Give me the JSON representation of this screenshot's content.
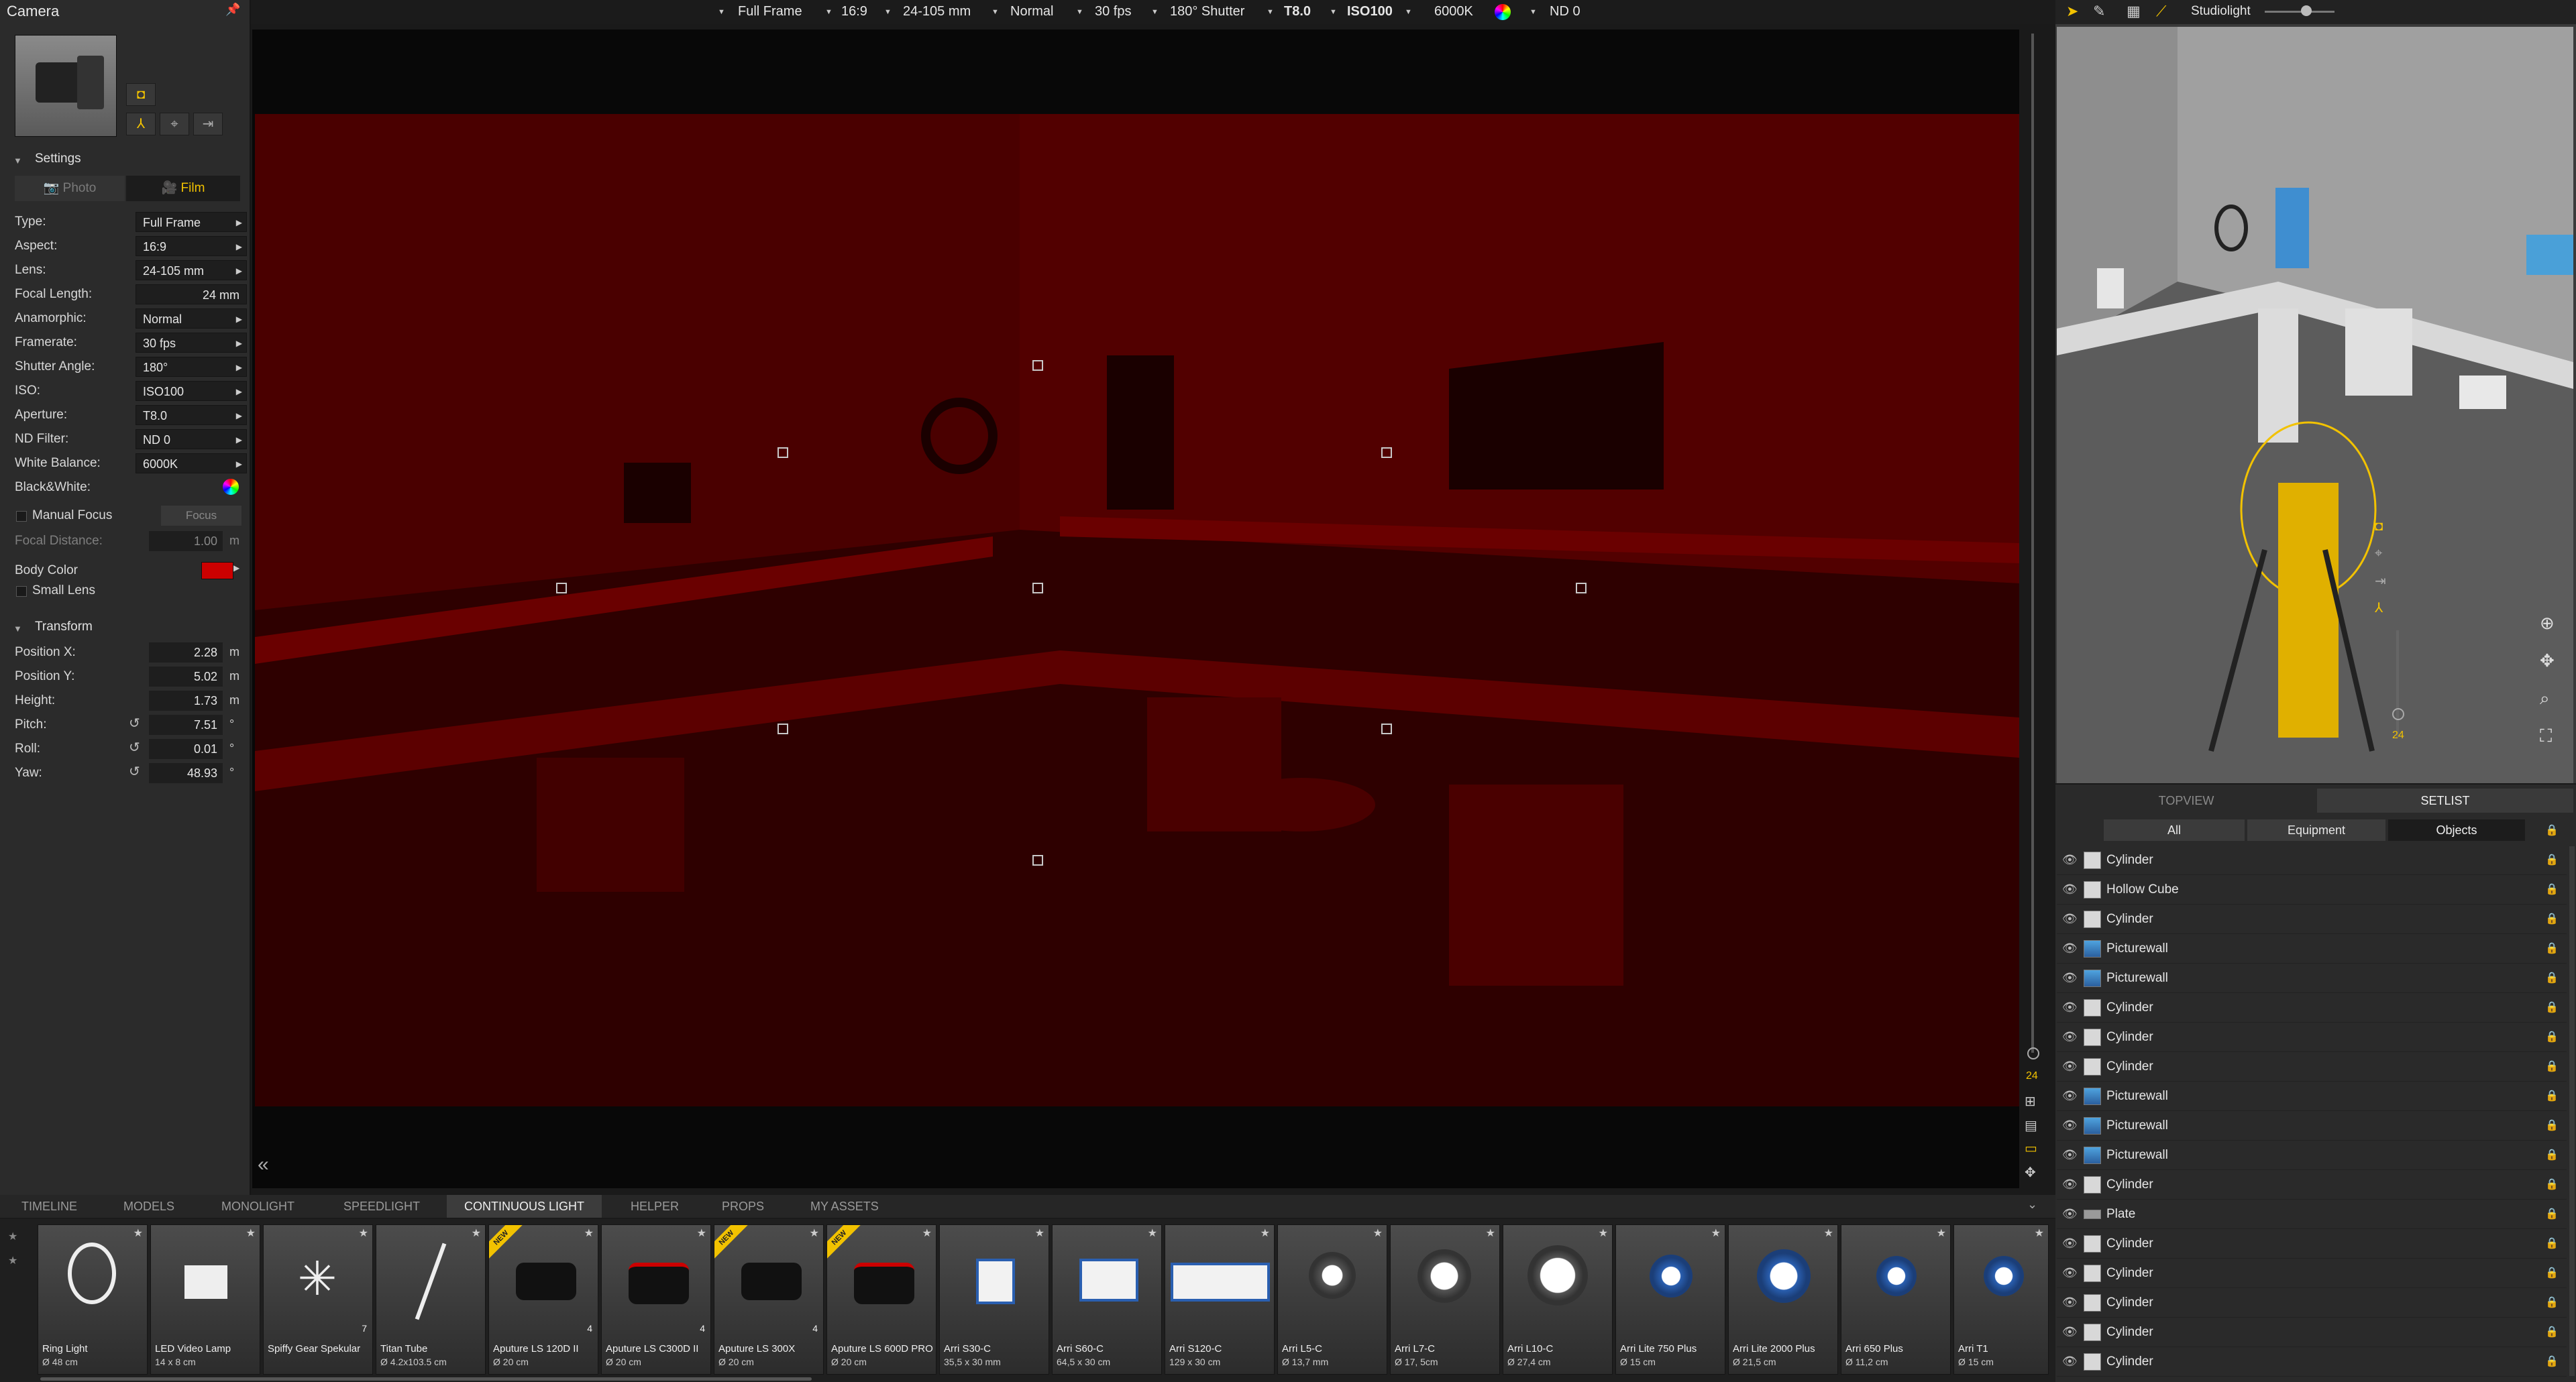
{
  "left_panel": {
    "title": "Camera",
    "settings_label": "Settings",
    "mode_photo": "Photo",
    "mode_film": "Film",
    "settings": [
      {
        "label": "Type:",
        "value": "Full Frame"
      },
      {
        "label": "Aspect:",
        "value": "16:9"
      },
      {
        "label": "Lens:",
        "value": "24-105 mm"
      },
      {
        "label": "Focal Length:",
        "value": "24 mm"
      },
      {
        "label": "Anamorphic:",
        "value": "Normal"
      },
      {
        "label": "Framerate:",
        "value": "30 fps"
      },
      {
        "label": "Shutter Angle:",
        "value": "180°"
      },
      {
        "label": "ISO:",
        "value": "ISO100"
      },
      {
        "label": "Aperture:",
        "value": "T8.0"
      },
      {
        "label": "ND Filter:",
        "value": "ND 0"
      },
      {
        "label": "White Balance:",
        "value": "6000K"
      },
      {
        "label": "Black&White:",
        "value": ""
      }
    ],
    "manual_focus_label": "Manual Focus",
    "focus_button": "Focus",
    "focal_distance_label": "Focal Distance:",
    "focal_distance_value": "1.00",
    "focal_distance_unit": "m",
    "body_color_label": "Body Color",
    "body_color": "#cc0000",
    "small_lens_label": "Small Lens",
    "transform_label": "Transform",
    "transform": [
      {
        "label": "Position X:",
        "value": "2.28",
        "unit": "m"
      },
      {
        "label": "Position Y:",
        "value": "5.02",
        "unit": "m"
      },
      {
        "label": "Height:",
        "value": "1.73",
        "unit": "m"
      },
      {
        "label": "Pitch:",
        "value": "7.51",
        "unit": "°"
      },
      {
        "label": "Roll:",
        "value": "0.01",
        "unit": "°"
      },
      {
        "label": "Yaw:",
        "value": "48.93",
        "unit": "°"
      }
    ]
  },
  "toolbar": {
    "items": [
      "Full Frame",
      "16:9",
      "24-105 mm",
      "Normal",
      "30 fps",
      "180° Shutter",
      "T8.0",
      "ISO100",
      "6000K",
      "ND 0"
    ]
  },
  "right_panel": {
    "mode_label": "Studiolight",
    "zoom_level": "24",
    "view_tabs": [
      "TOPVIEW",
      "SETLIST"
    ],
    "filter_tabs": [
      "All",
      "Equipment",
      "Objects"
    ],
    "objects": [
      {
        "name": "Cylinder",
        "icon": "cylinder"
      },
      {
        "name": "Hollow Cube",
        "icon": "cube"
      },
      {
        "name": "Cylinder",
        "icon": "cylinder"
      },
      {
        "name": "Picturewall",
        "icon": "picture"
      },
      {
        "name": "Picturewall",
        "icon": "picture"
      },
      {
        "name": "Cylinder",
        "icon": "cylinder"
      },
      {
        "name": "Cylinder",
        "icon": "cylinder"
      },
      {
        "name": "Cylinder",
        "icon": "cylinder"
      },
      {
        "name": "Picturewall",
        "icon": "picture"
      },
      {
        "name": "Picturewall",
        "icon": "picture"
      },
      {
        "name": "Picturewall",
        "icon": "picture"
      },
      {
        "name": "Cylinder",
        "icon": "cylinder"
      },
      {
        "name": "Plate",
        "icon": "plate"
      },
      {
        "name": "Cylinder",
        "icon": "cylinder"
      },
      {
        "name": "Cylinder",
        "icon": "cylinder"
      },
      {
        "name": "Cylinder",
        "icon": "cylinder"
      },
      {
        "name": "Cylinder",
        "icon": "cylinder"
      },
      {
        "name": "Cylinder",
        "icon": "cylinder"
      }
    ]
  },
  "viewport": {
    "zoom_level": "24"
  },
  "bottom": {
    "tabs": [
      "TIMELINE",
      "MODELS",
      "MONOLIGHT",
      "SPEEDLIGHT",
      "CONTINUOUS LIGHT",
      "HELPER",
      "PROPS",
      "MY ASSETS"
    ],
    "active_tab": "CONTINUOUS LIGHT",
    "new_badge": "NEW",
    "items": [
      {
        "name": "Ring Light",
        "size": "Ø 48 cm",
        "icon": "ring-light"
      },
      {
        "name": "LED Video Lamp",
        "size": "14 x 8 cm",
        "icon": "led-panel"
      },
      {
        "name": "Spiffy Gear Spekular",
        "size": "",
        "icon": "star-light",
        "count": "7"
      },
      {
        "name": "Titan Tube",
        "size": "Ø 4.2x103.5 cm",
        "icon": "tube"
      },
      {
        "name": "Aputure LS 120D II",
        "size": "Ø 20 cm",
        "icon": "cob-light",
        "count": "4",
        "new": true
      },
      {
        "name": "Aputure LS C300D II",
        "size": "Ø 20 cm",
        "icon": "cob-light-red",
        "count": "4"
      },
      {
        "name": "Aputure LS 300X",
        "size": "Ø 20 cm",
        "icon": "cob-light",
        "count": "4",
        "new": true
      },
      {
        "name": "Aputure LS 600D PRO",
        "size": "Ø 20 cm",
        "icon": "cob-light-red",
        "new": true
      },
      {
        "name": "Arri S30-C",
        "size": "35,5 x 30 mm",
        "icon": "skypanel-small"
      },
      {
        "name": "Arri S60-C",
        "size": "64,5 x 30 cm",
        "icon": "skypanel"
      },
      {
        "name": "Arri S120-C",
        "size": "129 x 30 cm",
        "icon": "skypanel-wide"
      },
      {
        "name": "Arri L5-C",
        "size": "Ø 13,7 mm",
        "icon": "fresnel"
      },
      {
        "name": "Arri L7-C",
        "size": "Ø 17, 5cm",
        "icon": "fresnel"
      },
      {
        "name": "Arri L10-C",
        "size": "Ø 27,4 cm",
        "icon": "fresnel"
      },
      {
        "name": "Arri Lite 750 Plus",
        "size": "Ø 15 cm",
        "icon": "fresnel-blue"
      },
      {
        "name": "Arri Lite 2000 Plus",
        "size": "Ø 21,5 cm",
        "icon": "fresnel-blue"
      },
      {
        "name": "Arri 650 Plus",
        "size": "Ø 11,2 cm",
        "icon": "fresnel-blue"
      },
      {
        "name": "Arri T1",
        "size": "Ø 15 cm",
        "icon": "fresnel-blue"
      }
    ]
  },
  "colors": {
    "accent": "#f2c200",
    "render_tint": "#4a0000"
  }
}
